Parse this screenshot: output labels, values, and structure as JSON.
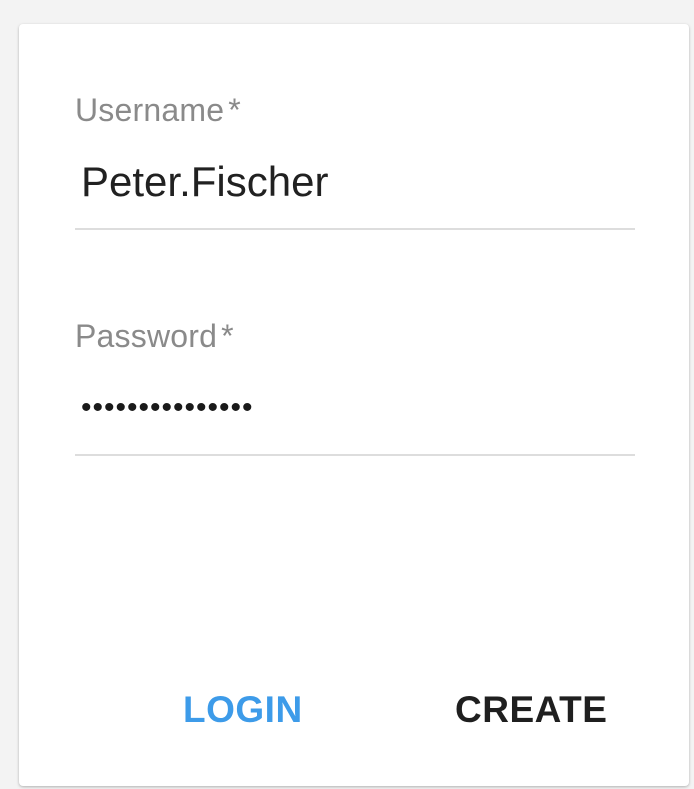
{
  "form": {
    "username": {
      "label": "Username",
      "required_marker": "*",
      "value": "Peter.Fischer"
    },
    "password": {
      "label": "Password",
      "required_marker": "*",
      "masked_value": "•••••••••••••••"
    }
  },
  "actions": {
    "login_label": "LOGIN",
    "create_label": "CREATE"
  },
  "colors": {
    "primary": "#3d9be9",
    "text": "#212121",
    "label": "#8a8a8a",
    "divider": "#dddddd",
    "background": "#f3f3f3",
    "card": "#ffffff"
  }
}
